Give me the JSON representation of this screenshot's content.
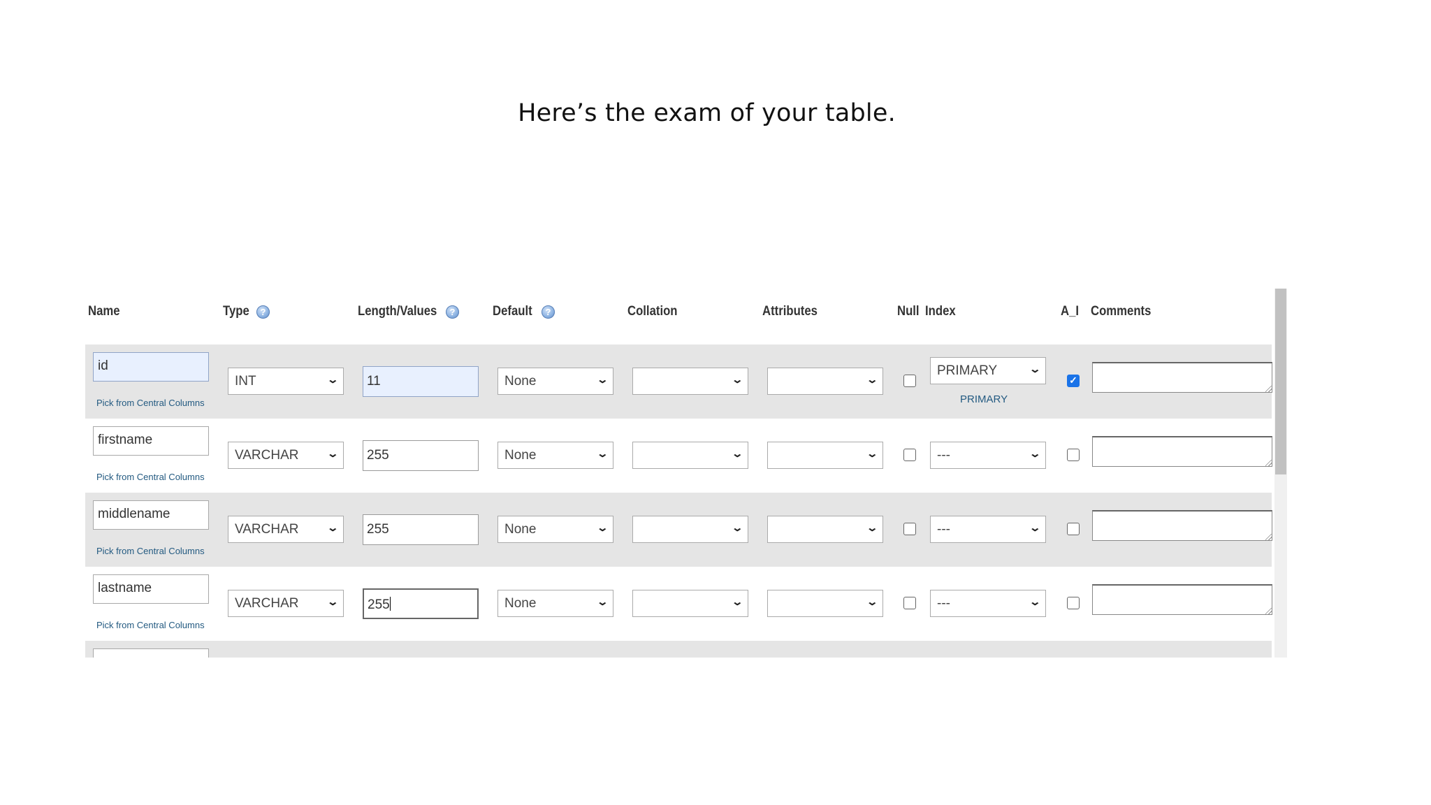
{
  "slide": {
    "title": "Here’s the exam of your table."
  },
  "headers": {
    "name": "Name",
    "type": "Type",
    "length": "Length/Values",
    "default": "Default",
    "collation": "Collation",
    "attributes": "Attributes",
    "null": "Null",
    "index": "Index",
    "ai": "A_I",
    "comments": "Comments",
    "help_icon": "?"
  },
  "rows": [
    {
      "name": "id",
      "pick_label": "Pick from Central Columns",
      "type": "INT",
      "length": "11",
      "default": "None",
      "collation": "",
      "attributes": "",
      "null": false,
      "index": "PRIMARY",
      "index_label": "PRIMARY",
      "ai": true,
      "comments": ""
    },
    {
      "name": "firstname",
      "pick_label": "Pick from Central Columns",
      "type": "VARCHAR",
      "length": "255",
      "default": "None",
      "collation": "",
      "attributes": "",
      "null": false,
      "index": "---",
      "ai": false,
      "comments": ""
    },
    {
      "name": "middlename",
      "pick_label": "Pick from Central Columns",
      "type": "VARCHAR",
      "length": "255",
      "default": "None",
      "collation": "",
      "attributes": "",
      "null": false,
      "index": "---",
      "ai": false,
      "comments": ""
    },
    {
      "name": "lastname",
      "pick_label": "Pick from Central Columns",
      "type": "VARCHAR",
      "length": "255",
      "default": "None",
      "collation": "",
      "attributes": "",
      "null": false,
      "index": "---",
      "ai": false,
      "comments": ""
    }
  ],
  "colors": {
    "row_shade": "#e5e5e5",
    "link": "#235a81",
    "focus_fill": "#e8f0fe",
    "checkbox_checked": "#1a73e8"
  },
  "icons": {
    "select_arrow": "chevron-down-icon",
    "help": "help-icon",
    "checkmark": "check-icon"
  }
}
